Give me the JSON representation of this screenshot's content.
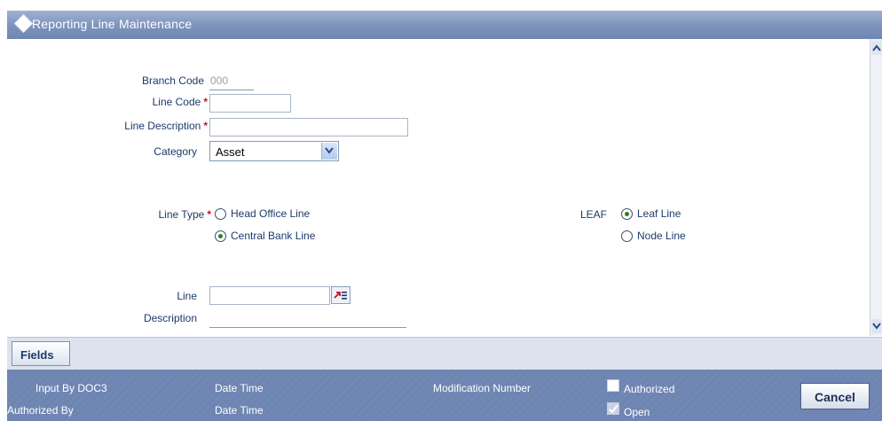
{
  "window": {
    "title": "Reporting Line Maintenance"
  },
  "form": {
    "branch_code": {
      "label": "Branch Code",
      "value": "000"
    },
    "line_code": {
      "label": "Line Code",
      "required_mark": "*",
      "value": ""
    },
    "line_description": {
      "label": "Line Description",
      "required_mark": "*",
      "value": ""
    },
    "category": {
      "label": "Category",
      "selected": "Asset"
    },
    "line_type": {
      "label": "Line Type",
      "required_mark": "*",
      "options": [
        {
          "label": "Head Office Line",
          "selected": false
        },
        {
          "label": "Central Bank Line",
          "selected": true
        }
      ]
    },
    "leaf": {
      "label": "LEAF",
      "options": [
        {
          "label": "Leaf Line",
          "selected": true
        },
        {
          "label": "Node Line",
          "selected": false
        }
      ]
    },
    "line": {
      "label": "Line",
      "value": ""
    },
    "description": {
      "label": "Description",
      "value": ""
    }
  },
  "fields_button": "Fields",
  "footer": {
    "input_by": "Input By DOC3",
    "authorized_by": "Authorized By",
    "date_time_1": "Date Time",
    "date_time_2": "Date Time",
    "modification_number": "Modification Number",
    "authorized": {
      "label": "Authorized",
      "checked": false
    },
    "open": {
      "label": "Open",
      "checked": true
    },
    "cancel": "Cancel"
  },
  "colors": {
    "title_bar": "#7d93bd",
    "footer": "#6e84b1",
    "required": "#c8102e",
    "radio_dot": "#2a7f2a"
  },
  "icons": {
    "title": "diamond-icon",
    "lov": "list-of-values-icon",
    "dropdown": "chevron-down-icon"
  }
}
